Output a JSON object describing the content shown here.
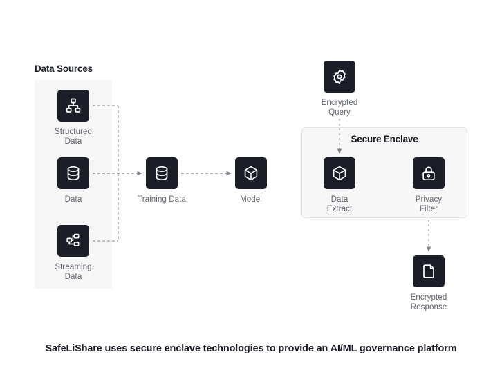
{
  "sections": {
    "data_sources_heading": "Data Sources",
    "secure_enclave_heading": "Secure Enclave"
  },
  "nodes": {
    "structured": {
      "label": "Structured\nData",
      "icon": "hierarchy-icon"
    },
    "data": {
      "label": "Data",
      "icon": "database-icon"
    },
    "streaming": {
      "label": "Streaming\nData",
      "icon": "branch-tree-icon"
    },
    "training": {
      "label": "Training Data",
      "icon": "database-icon"
    },
    "model": {
      "label": "Model",
      "icon": "cube-icon"
    },
    "encrypted_query": {
      "label": "Encrypted\nQuery",
      "icon": "gear-icon"
    },
    "data_extract": {
      "label": "Data\nExtract",
      "icon": "cube-icon"
    },
    "privacy_filter": {
      "label": "Privacy\nFilter",
      "icon": "lock-icon"
    },
    "encrypted_response": {
      "label": "Encrypted\nResponse",
      "icon": "document-icon"
    }
  },
  "caption": "SafeLiShare uses secure enclave technologies to provide an AI/ML governance platform",
  "colors": {
    "tile_background": "#1b1e27",
    "tile_icon": "#ffffff",
    "panel_background": "#f6f6f7",
    "enclave_border": "#e3e4e6",
    "label_text": "#62666e",
    "heading_text": "#1b1e27",
    "connector": "#9a9ea6"
  }
}
